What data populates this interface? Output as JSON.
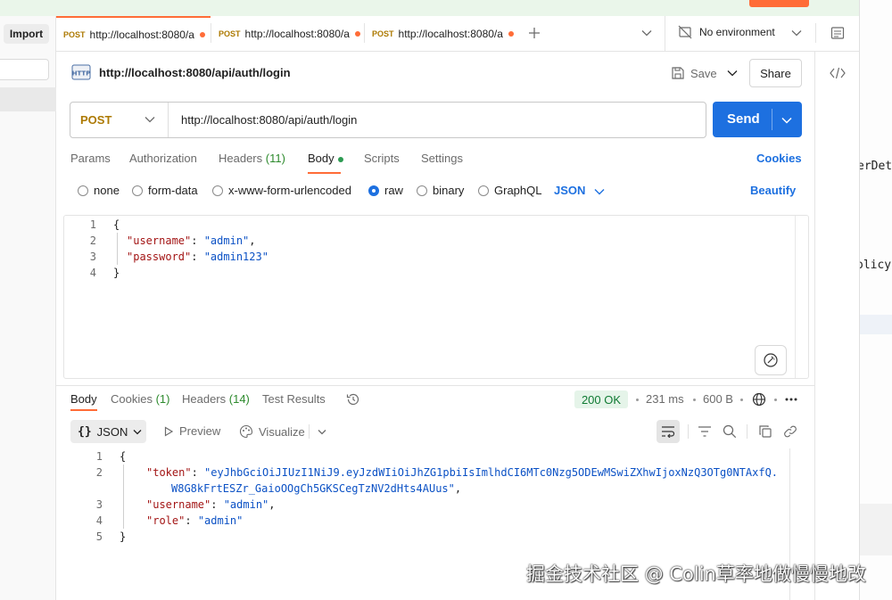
{
  "sidebar": {
    "import_label": "Import"
  },
  "tabs": [
    {
      "method": "POST",
      "label": "http://localhost:8080/a"
    },
    {
      "method": "POST",
      "label": "http://localhost:8080/a"
    },
    {
      "method": "POST",
      "label": "http://localhost:8080/a"
    }
  ],
  "environment": {
    "label": "No environment"
  },
  "request": {
    "title": "http://localhost:8080/api/auth/login",
    "save_label": "Save",
    "share_label": "Share",
    "method": "POST",
    "url": "http://localhost:8080/api/auth/login",
    "send_label": "Send",
    "subtabs": {
      "params": "Params",
      "authorization": "Authorization",
      "headers": "Headers",
      "headers_count": "(11)",
      "body": "Body",
      "scripts": "Scripts",
      "settings": "Settings"
    },
    "cookies_label": "Cookies",
    "body_types": [
      "none",
      "form-data",
      "x-www-form-urlencoded",
      "raw",
      "binary",
      "GraphQL"
    ],
    "body_type_selected": "raw",
    "format": "JSON",
    "beautify_label": "Beautify",
    "code": {
      "line_numbers": [
        "1",
        "2",
        "3",
        "4"
      ],
      "open": "{",
      "k1": "\"username\"",
      "v1": "\"admin\"",
      "k2": "\"password\"",
      "v2": "\"admin123\"",
      "close": "}"
    }
  },
  "response": {
    "tabs": {
      "body": "Body",
      "cookies": "Cookies",
      "cookies_count": "(1)",
      "headers": "Headers",
      "headers_count": "(14)",
      "test_results": "Test Results"
    },
    "status": "200 OK",
    "time": "231 ms",
    "size": "600 B",
    "format": "JSON",
    "preview_label": "Preview",
    "visualize_label": "Visualize",
    "code": {
      "line_numbers": [
        "1",
        "2",
        "3",
        "4",
        "5"
      ],
      "open": "{",
      "token_key": "\"token\"",
      "token_val_1": "\"eyJhbGciOiJIUzI1NiJ9.eyJzdWIiOiJhZG1pbiIsImlhdCI6MTc0Nzg5ODEwMSwiZXhwIjoxNzQ3OTg0NTAxfQ.",
      "token_val_2": "W8G8kFrtESZr_GaioOOgCh5GKSCegTzNV2dHts4AUus\"",
      "username_key": "\"username\"",
      "username_val": "\"admin\"",
      "role_key": "\"role\"",
      "role_val": "\"admin\"",
      "close": "}"
    }
  },
  "background_window": {
    "line1": "erDeta",
    "line2": "olicy"
  },
  "watermark": "掘金技术社区 @ Colin草率地做慢慢地改",
  "colors": {
    "accent": "#ff6c37",
    "primary": "#1d70e0",
    "success": "#0f7a33",
    "method_post": "#ad7a03"
  }
}
